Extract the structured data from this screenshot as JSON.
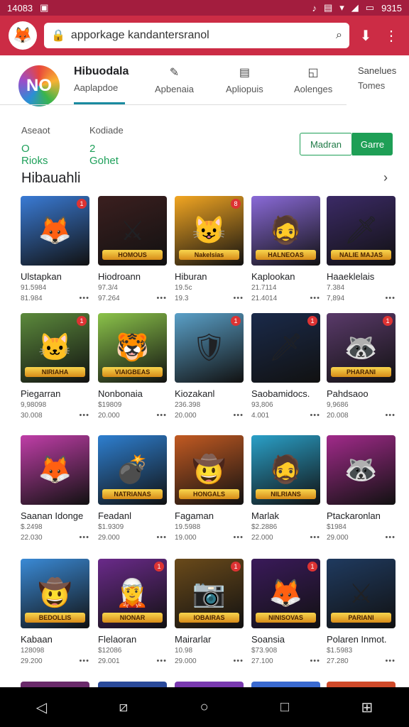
{
  "status": {
    "time": "14083",
    "clock_right": "9315"
  },
  "browser": {
    "url": "apporkage kandantersranol"
  },
  "header": {
    "logo_text": "NO",
    "tabs": [
      {
        "title": "Hibuodala",
        "label": "Aaplapdoe"
      },
      {
        "label": "Apbenaia",
        "icon": "edit-icon"
      },
      {
        "label": "Apliopuis",
        "icon": "list-icon"
      },
      {
        "label": "Aolenges",
        "icon": "chart-icon"
      },
      {
        "title": "Sanelues",
        "label": "Tomes"
      }
    ]
  },
  "stats": [
    {
      "label": "Aseaot",
      "value": "O Rioks"
    },
    {
      "label": "Kodiade",
      "value": "2 Gohet"
    }
  ],
  "buttons": {
    "outline": "Madran",
    "solid": "Garre"
  },
  "section": {
    "title": "Hibauahli"
  },
  "games": [
    {
      "name": "Ulstapkan",
      "meta": "91.5984",
      "badge": "1",
      "bg": "#3a7bd5",
      "face": "🦊"
    },
    {
      "name": "Hiodroann",
      "meta": "97.3/4",
      "banner": "HOMOUS",
      "bg": "#3b1f1f",
      "face": "⚔"
    },
    {
      "name": "Hiburan",
      "meta": "19.5c",
      "banner": "Nakelsias",
      "badge": "8",
      "bg": "#f2a622",
      "face": "😺"
    },
    {
      "name": "Kaplookan",
      "meta": "21.7114",
      "banner": "HALNEOAS",
      "bg": "#8a6ad8",
      "face": "🧔"
    },
    {
      "name": "Haaeklelais",
      "meta": "7.384",
      "banner": "NALIE MAJAS",
      "bg": "#3b2a66",
      "face": "🗡"
    },
    {
      "name": "Piegarran",
      "meta": "9,98098",
      "banner": "NIRIAHA",
      "badge": "1",
      "bg": "#5c8a3c",
      "face": "🐱"
    },
    {
      "name": "Nonbonaia",
      "meta": "$19809",
      "banner": "VIAIGBEAS",
      "bg": "#8bc34a",
      "face": "🐯"
    },
    {
      "name": "Kiozakanl",
      "meta": "236.398",
      "badge": "1",
      "bg": "#5aa0c8",
      "face": "🛡"
    },
    {
      "name": "Saobamidocs.",
      "meta": "93,806",
      "badge": "1",
      "bg": "#1a2a4a",
      "face": "🗡"
    },
    {
      "name": "Pahdsaoo",
      "meta": "9,9686",
      "banner": "PHARANI",
      "badge": "1",
      "bg": "#5a3a6a",
      "face": "🦝"
    },
    {
      "name": "Saanan Idonge",
      "meta": "$.2498",
      "bg": "#c03ea8",
      "face": "🦊"
    },
    {
      "name": "Feadanl",
      "meta": "$1.9309",
      "banner": "NATRIANAS",
      "bg": "#2e7fd0",
      "face": "💣"
    },
    {
      "name": "Fagaman",
      "meta": "19.5988",
      "banner": "HONGALS",
      "bg": "#c25a22",
      "face": "🤠"
    },
    {
      "name": "Marlak",
      "meta": "$2.2886",
      "banner": "NILRIANS",
      "bg": "#2aa0c8",
      "face": "🧔"
    },
    {
      "name": "Ptackaronlan",
      "meta": "$1984",
      "bg": "#a12a8a",
      "face": "🦝"
    },
    {
      "name": "Kabaan",
      "meta": "128098",
      "banner": "BEDOLLIS",
      "bg": "#3a8ad6",
      "face": "🤠"
    },
    {
      "name": "Flelaoran",
      "meta": "$12086",
      "banner": "NIONAR",
      "badge": "1",
      "bg": "#6a2a8a",
      "face": "🧝"
    },
    {
      "name": "Mairarlar",
      "meta": "10.98",
      "banner": "IOBAIRAS",
      "badge": "1",
      "bg": "#6a4a1a",
      "face": "📷"
    },
    {
      "name": "Soansia",
      "meta": "$73.908",
      "banner": "NINISOVAS",
      "badge": "1",
      "bg": "#3a1a5a",
      "face": "🦊"
    },
    {
      "name": "Polaren Inmot.",
      "meta": "$1.5983",
      "banner": "PARIANI",
      "bg": "#1f3a5f",
      "face": "⚔"
    }
  ],
  "games_secondary_meta": [
    "81.984",
    "97.264",
    "19.3",
    "21.4014",
    "7,894",
    "30.008",
    "20.000",
    "20.000",
    "4.001",
    "20.008",
    "22.030",
    "29.000",
    "19.000",
    "22.000",
    "29.000",
    "29.200",
    "29.001",
    "29.000",
    "27.100",
    "27.280"
  ]
}
